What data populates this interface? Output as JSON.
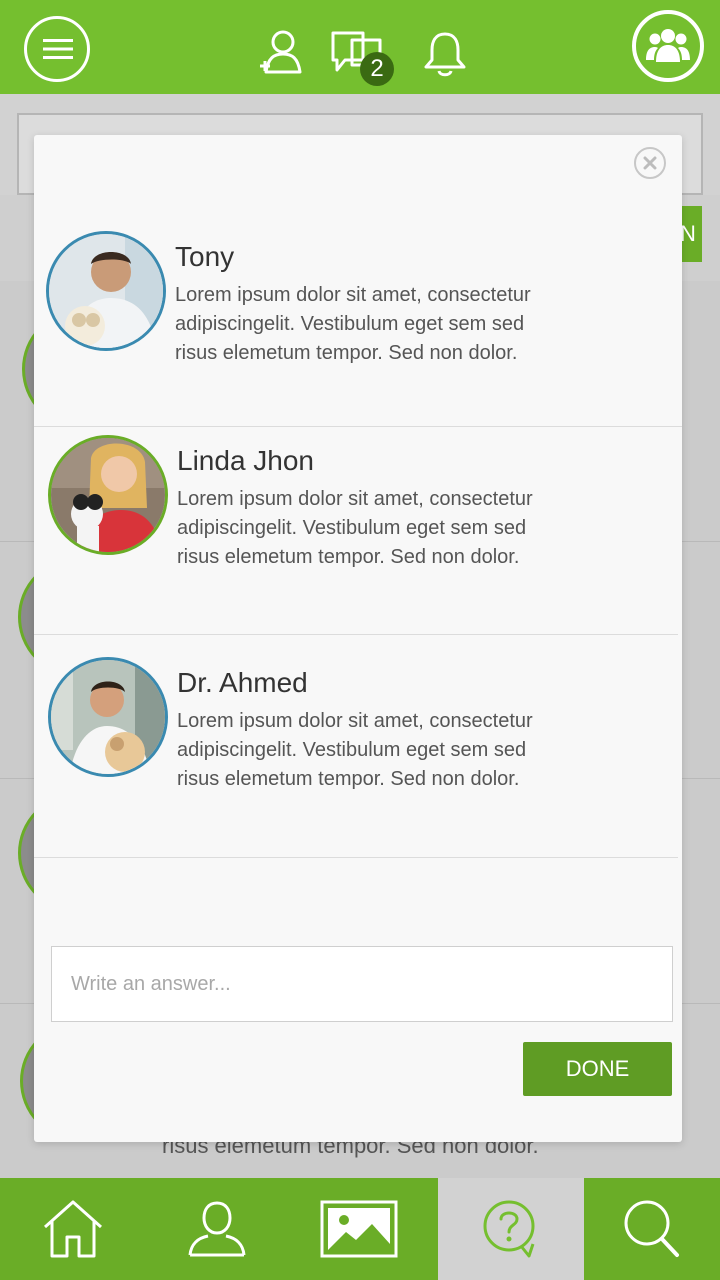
{
  "header": {
    "menu_icon": "hamburger-icon",
    "add_friend_icon": "add-user-icon",
    "messages_icon": "chat-icon",
    "messages_badge": "2",
    "notifications_icon": "bell-icon",
    "groups_icon": "group-icon"
  },
  "background": {
    "button_label": "N",
    "visible_text": "risus elemetum tempor. Sed non dolor."
  },
  "modal": {
    "close_icon": "close-icon",
    "contacts": [
      {
        "name": "Tony",
        "message": "Lorem ipsum dolor sit amet, consectetur adipiscingelit. Vestibulum eget sem sed risus elemetum tempor. Sed non dolor."
      },
      {
        "name": "Linda Jhon",
        "message": "Lorem ipsum dolor sit amet, consectetur adipiscingelit. Vestibulum eget sem sed risus elemetum tempor. Sed non dolor."
      },
      {
        "name": "Dr. Ahmed",
        "message": "Lorem ipsum dolor sit amet, consectetur adipiscingelit. Vestibulum eget sem sed risus elemetum tempor. Sed non dolor."
      }
    ],
    "answer_placeholder": "Write an answer...",
    "done_label": "DONE"
  },
  "bottom_nav": {
    "items": [
      {
        "icon": "home-icon",
        "active": false
      },
      {
        "icon": "profile-icon",
        "active": false
      },
      {
        "icon": "gallery-icon",
        "active": false
      },
      {
        "icon": "question-icon",
        "active": true
      },
      {
        "icon": "search-icon",
        "active": false
      }
    ]
  },
  "colors": {
    "brand_green": "#75bf2f",
    "button_green": "#5f9c24",
    "avatar_blue_border": "#3a8ab0",
    "avatar_green_border": "#6aad27"
  }
}
